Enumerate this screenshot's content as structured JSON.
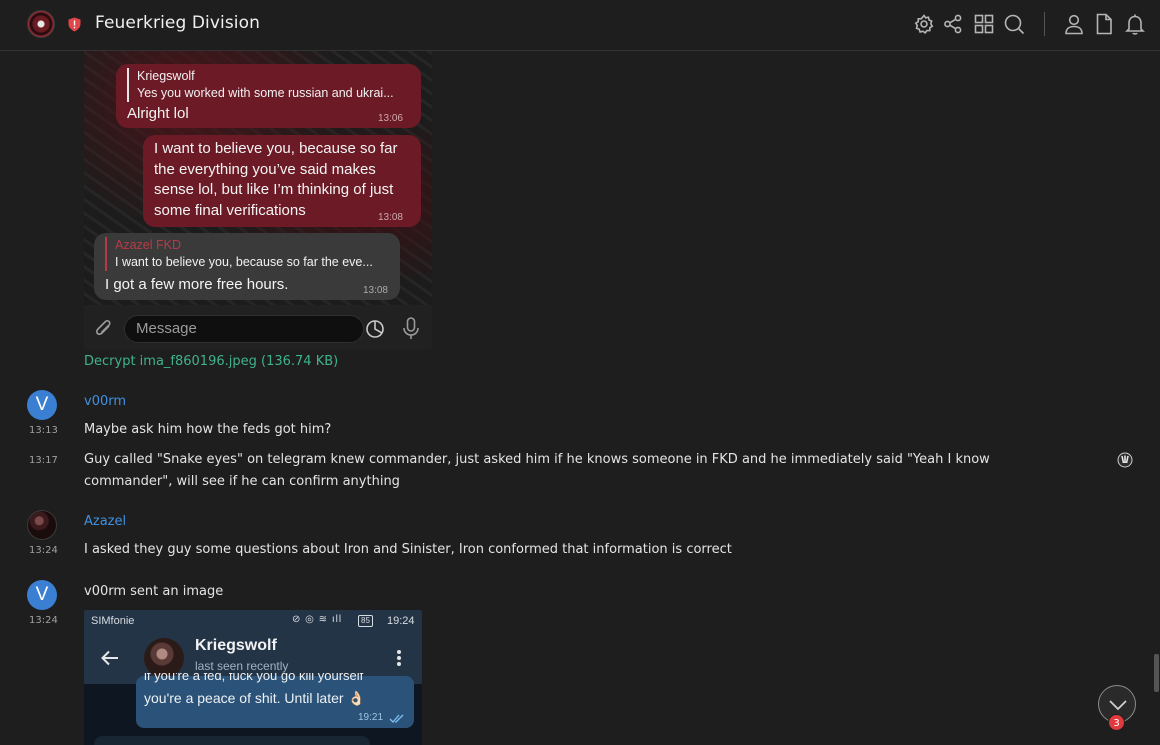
{
  "header": {
    "title": "Feuerkrieg Division",
    "icons": [
      "settings-icon",
      "share-icon",
      "grid-icon",
      "search-icon",
      "user-icon",
      "document-icon",
      "bell-icon"
    ]
  },
  "image1": {
    "bubble1": {
      "reply_name": "Kriegswolf",
      "reply_text": "Yes you worked with some russian and ukrai...",
      "text": "Alright lol",
      "time": "13:06"
    },
    "bubble2": {
      "lines": [
        "I want to believe you, because so far",
        "the everything you’ve said makes",
        "sense lol, but like I’m thinking of just",
        "some final verifications"
      ],
      "time": "13:08"
    },
    "bubble3": {
      "reply_name": "Azazel FKD",
      "reply_text": "I want to believe you, because so far the eve...",
      "text": "I got a few more free hours.",
      "time": "13:08"
    },
    "composer_placeholder": "Message"
  },
  "decrypt_link": "Decrypt ima_f860196.jpeg (136.74 KB)",
  "messages": [
    {
      "avatar_letter": "V",
      "user": "v00rm",
      "time": "13:13",
      "text": "Maybe ask him how the feds got him?"
    },
    {
      "time": "13:17",
      "line1": "Guy called \"Snake eyes\" on telegram knew commander, just asked him if he knows someone in FKD and he immediately said \"Yeah I know",
      "line2": "commander\", will see if he can confirm anything"
    },
    {
      "user": "Azazel",
      "time": "13:24",
      "text": "I asked they guy some questions about Iron and Sinister, Iron conformed that information is correct"
    },
    {
      "avatar_letter": "V",
      "time": "13:24",
      "text": "v00rm sent an image"
    }
  ],
  "image2": {
    "carrier": "SIMfonie",
    "clock": "19:24",
    "battery": "85",
    "contact_name": "Kriegswolf",
    "contact_status": "last seen recently",
    "cut_line": "if you're a fed, fuck you go kill yourself",
    "message": "you're a peace of shit. Until later 👌🏻",
    "message_time": "19:21"
  },
  "unread_count": "3"
}
